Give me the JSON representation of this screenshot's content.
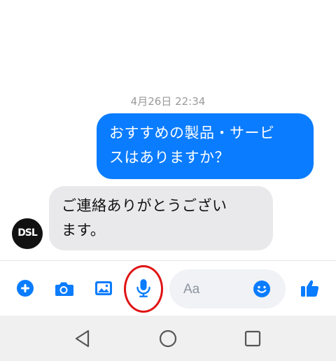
{
  "conversation": {
    "timestamp": "4月26日 22:34",
    "messages": [
      {
        "direction": "outgoing",
        "lines": [
          "おすすめの製品・サービ",
          "スはありますか？"
        ]
      },
      {
        "direction": "incoming",
        "lines": [
          "ご連絡ありがとうござい",
          "ます。"
        ]
      }
    ],
    "avatar_text": "DSL"
  },
  "composer": {
    "icons": [
      "plus-icon",
      "camera-icon",
      "image-icon",
      "microphone-icon",
      "emoji-icon",
      "thumbs-up-icon"
    ],
    "input_placeholder": "Aa"
  },
  "navbar": {
    "icons": [
      "back-triangle-icon",
      "home-circle-icon",
      "recents-square-icon"
    ]
  },
  "colors": {
    "accent": "#0a7cff",
    "incoming_bubble": "#e9e9eb",
    "highlight_circle": "#e01414",
    "navbar_bg": "#f0f0f0"
  }
}
